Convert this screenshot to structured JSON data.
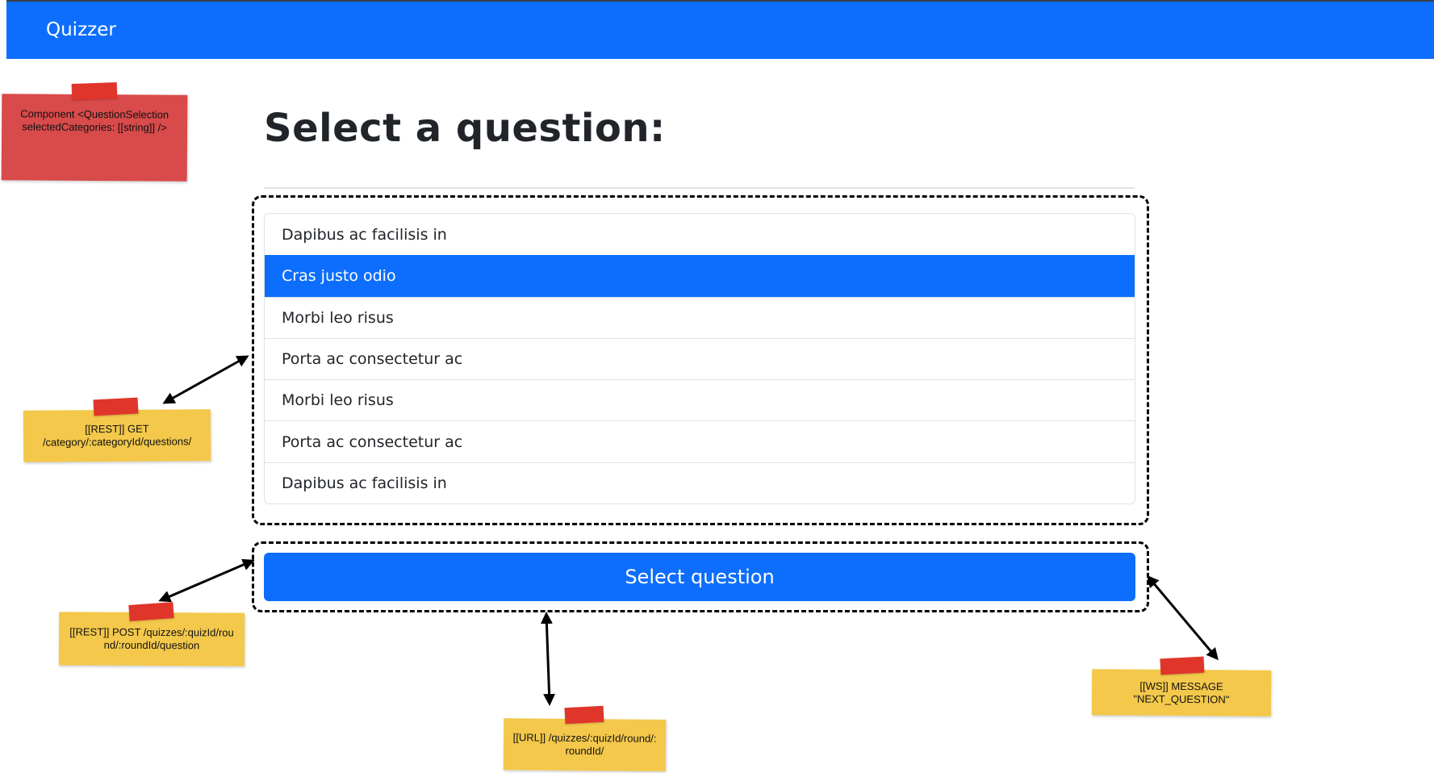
{
  "navbar": {
    "brand": "Quizzer",
    "color": "#0d6efd"
  },
  "main": {
    "title": "Select a question:",
    "questions": [
      {
        "label": "Dapibus ac facilisis in",
        "active": false
      },
      {
        "label": "Cras justo odio",
        "active": true
      },
      {
        "label": "Morbi leo risus",
        "active": false
      },
      {
        "label": "Porta ac consectetur ac",
        "active": false
      },
      {
        "label": "Morbi leo risus",
        "active": false
      },
      {
        "label": "Porta ac consectetur ac",
        "active": false
      },
      {
        "label": "Dapibus ac facilisis in",
        "active": false
      }
    ],
    "select_button_label": "Select question"
  },
  "annotations": {
    "component": "Component <QuestionSelection selectedCategories: [[string]] />",
    "rest_get": "[[REST]] GET /category/:categoryId/questions/",
    "rest_post": "[[REST]] POST /quizzes/:quizId/round/:roundId/question",
    "url": "[[URL]] /quizzes/:quizId/round/:roundId/",
    "ws": "[[WS]] MESSAGE \"NEXT_QUESTION\""
  },
  "colors": {
    "accent": "#0d6efd",
    "note_red": "#d94a4a",
    "note_yellow": "#f3c84b",
    "tape": "#e0352b"
  }
}
